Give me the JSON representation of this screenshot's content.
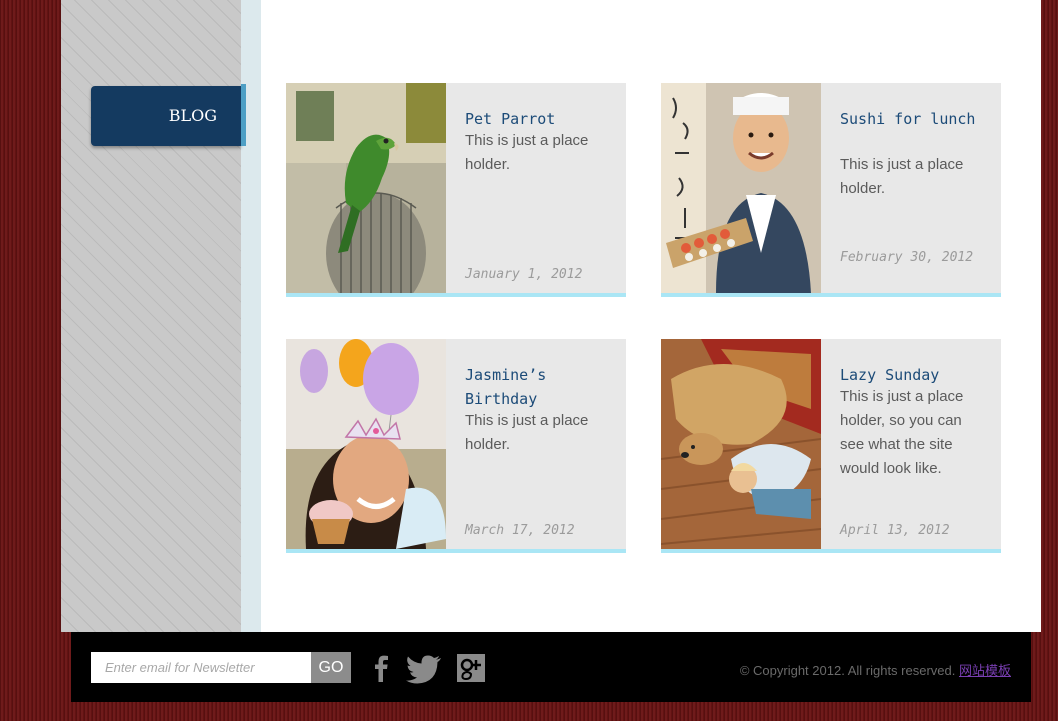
{
  "sidebar": {
    "nav_label": "BLOG"
  },
  "posts": [
    {
      "title": "Pet Parrot",
      "text": "This is just a place holder.",
      "date": "January 1, 2012",
      "image": "parrot-photo"
    },
    {
      "title": "Sushi for lunch",
      "text": "This is just a place holder.",
      "date": "February 30, 2012",
      "image": "sushi-chef-photo"
    },
    {
      "title": "Jasmine’s Birthday",
      "text": "This is just a place holder.",
      "date": "March 17, 2012",
      "image": "birthday-girl-photo"
    },
    {
      "title": "Lazy Sunday",
      "text": "This is just a place holder, so you can see what the site would look like.",
      "date": "April 13, 2012",
      "image": "dog-and-child-photo"
    }
  ],
  "footer": {
    "newsletter_placeholder": "Enter email for Newsletter",
    "go_label": "GO",
    "social": [
      "facebook-icon",
      "twitter-icon",
      "google-plus-icon"
    ],
    "copyright": "© Copyright 2012. All rights reserved.",
    "link_label": "网站模板"
  },
  "colors": {
    "background": "#6a1414",
    "nav_active": "#143a60",
    "card_bg": "#e8e8e8",
    "card_accent": "#aae6f5",
    "title": "#1c4b78"
  }
}
